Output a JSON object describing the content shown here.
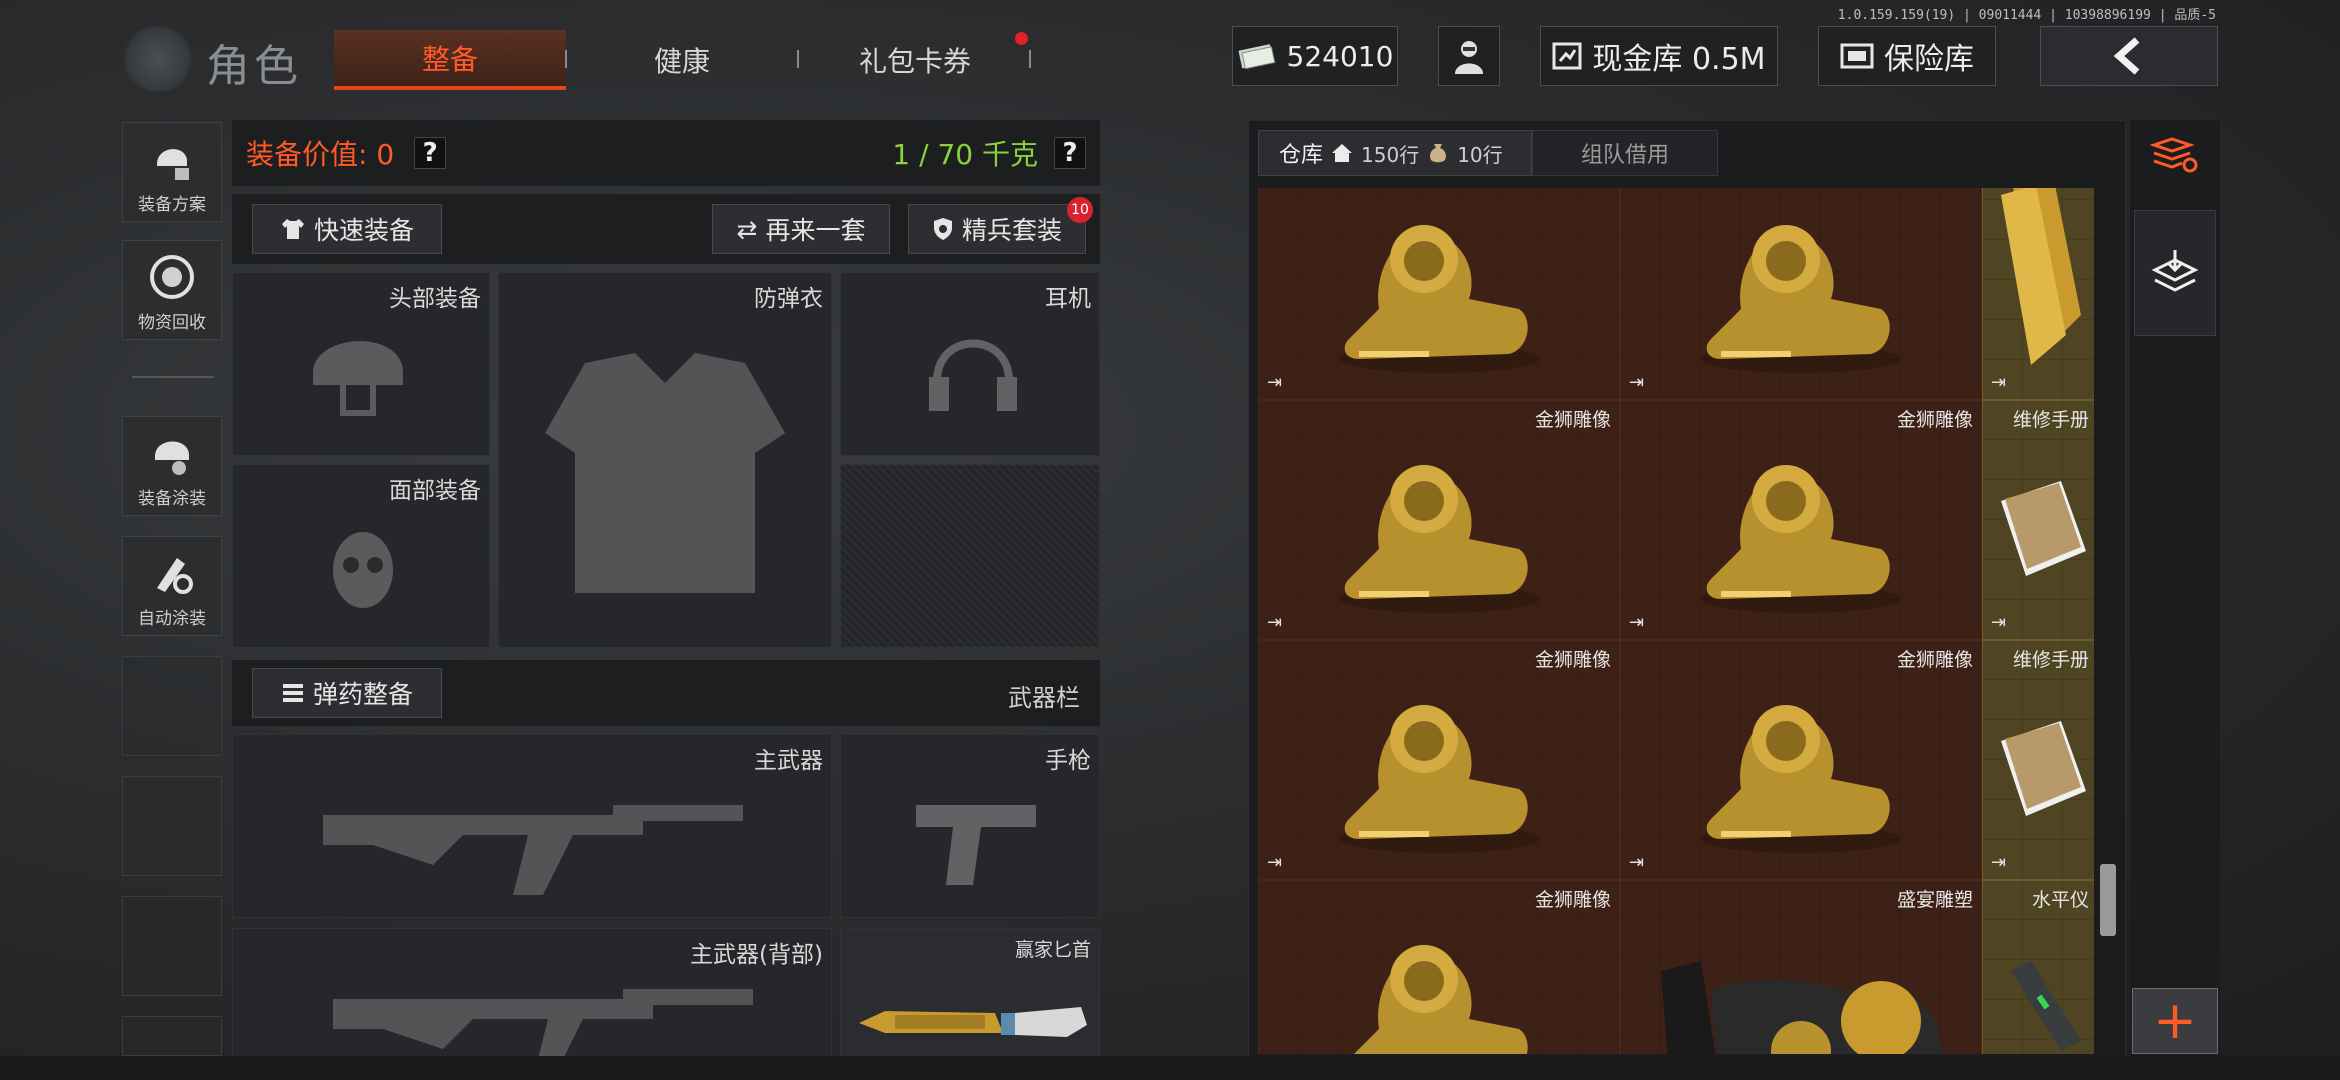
{
  "version_text": "1.0.159.159(19) | 09011444 | 10398896199 | 品质-5",
  "header": {
    "title": "角色",
    "tabs": [
      {
        "label": "整备",
        "active": true
      },
      {
        "label": "健康",
        "active": false
      },
      {
        "label": "礼包卡券",
        "active": false,
        "has_notification": true
      }
    ],
    "money": "524010",
    "cash_vault": "现金库 0.5M",
    "insurance": "保险库",
    "icons": {
      "money": "cash-icon",
      "profile": "operator-icon",
      "vault": "vault-icon",
      "insurance": "safe-icon",
      "back": "back-arrow-icon"
    }
  },
  "sidebar": [
    {
      "label": "装备方案",
      "icon": "loadout-plan-icon"
    },
    {
      "label": "物资回收",
      "icon": "recycle-icon"
    },
    {
      "label": "装备涂装",
      "icon": "skin-icon"
    },
    {
      "label": "自动涂装",
      "icon": "auto-skin-icon"
    }
  ],
  "loadout": {
    "value_label": "装备价值: 0",
    "weight_label": "1 / 70 千克",
    "quick_equip": "快速装备",
    "again": "再来一套",
    "elite": "精兵套装",
    "elite_badge": "10",
    "slots": {
      "helmet": "头部装备",
      "armor": "防弹衣",
      "headset": "耳机",
      "face": "面部装备",
      "primary": "主武器",
      "pistol": "手枪",
      "primary_back": "主武器(背部)",
      "knife": "赢家匕首"
    },
    "ammo": "弹药整备",
    "weapon_bar": "武器栏"
  },
  "inventory": {
    "tab_warehouse": "仓库",
    "rows_home": "150行",
    "rows_item": "10行",
    "tab_team": "组队借用",
    "items": [
      {
        "name": "金狮雕像",
        "col": 0,
        "row": 0,
        "kind": "lion",
        "partial": true
      },
      {
        "name": "金狮雕像",
        "col": 1,
        "row": 0,
        "kind": "lion",
        "partial": true
      },
      {
        "name": "金块",
        "col": 2,
        "row": 0,
        "kind": "gold",
        "partial": true
      },
      {
        "name": "金狮雕像",
        "col": 0,
        "row": 1,
        "kind": "lion"
      },
      {
        "name": "金狮雕像",
        "col": 1,
        "row": 1,
        "kind": "lion"
      },
      {
        "name": "维修手册",
        "col": 2,
        "row": 1,
        "kind": "manual"
      },
      {
        "name": "金狮雕像",
        "col": 0,
        "row": 2,
        "kind": "lion"
      },
      {
        "name": "金狮雕像",
        "col": 1,
        "row": 2,
        "kind": "lion"
      },
      {
        "name": "维修手册",
        "col": 2,
        "row": 2,
        "kind": "manual"
      },
      {
        "name": "金狮雕像",
        "col": 0,
        "row": 3,
        "kind": "lion"
      },
      {
        "name": "盛宴雕塑",
        "col": 1,
        "row": 3,
        "kind": "sculpture"
      },
      {
        "name": "水平仪",
        "col": 2,
        "row": 3,
        "kind": "level"
      }
    ]
  },
  "rail": {
    "icons": [
      "sort-icon",
      "layers-icon"
    ],
    "add": "+"
  },
  "colors": {
    "accent": "#ff5a28",
    "weight": "#8ad13a",
    "item_bg": "#3e2116",
    "item_bg_yellow": "#4f4523"
  }
}
